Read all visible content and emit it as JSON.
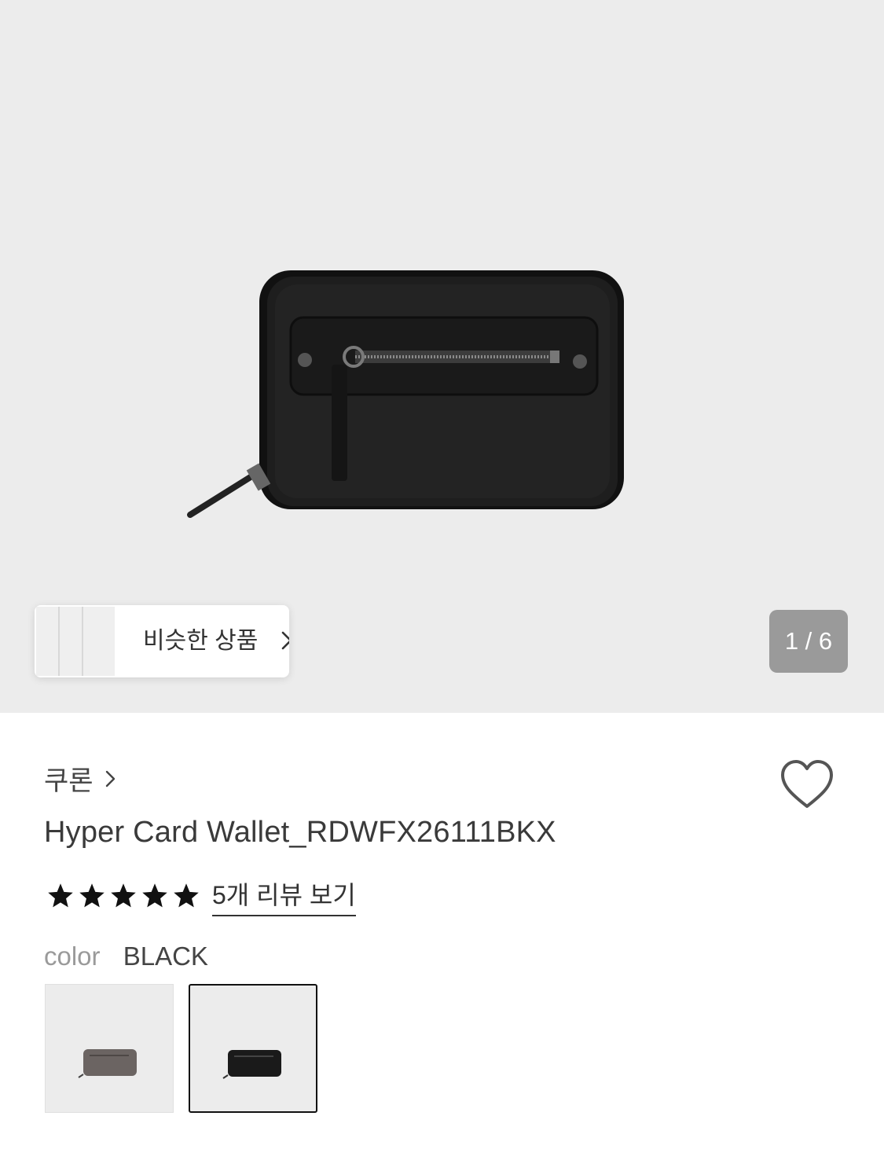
{
  "gallery": {
    "similar_label": "비슷한 상품",
    "counter": "1 / 6"
  },
  "product": {
    "brand": "쿠론",
    "title": "Hyper Card Wallet_RDWFX26111BKX",
    "rating": 5,
    "review_link": "5개 리뷰 보기",
    "color_label": "color",
    "color_value": "BLACK",
    "swatches": [
      {
        "name": "gray",
        "color": "#6b6462"
      },
      {
        "name": "black",
        "color": "#1a1a1a",
        "selected": true
      }
    ]
  },
  "colors": {
    "hero_bg": "#ececec",
    "wallet": "#1c1c1c",
    "counter_bg": "#8c8c8c"
  }
}
